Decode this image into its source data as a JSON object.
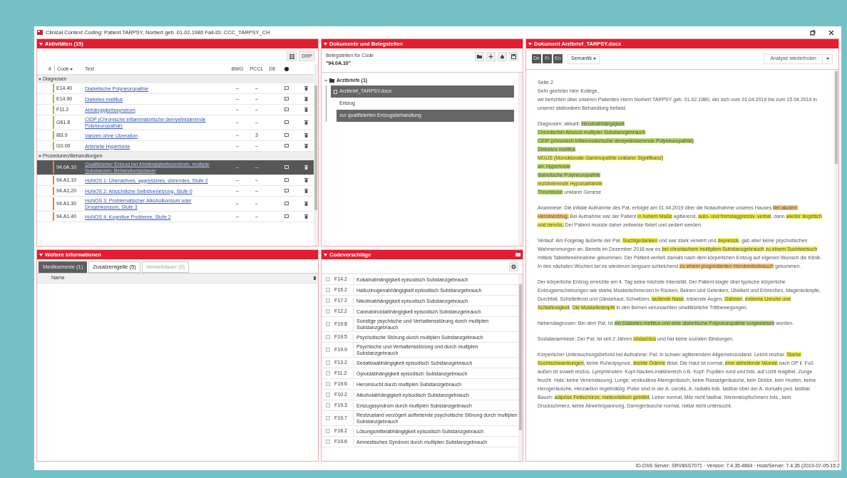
{
  "window": {
    "title": "Clinical Context Coding: Patient TARPSY, Norbert geb. 01.02.1980 Fall-ID: CCC_TARPSY_CH"
  },
  "activities": {
    "title": "Aktivitäten (15)",
    "toolbar_buttons": [
      "DRP"
    ],
    "columns": [
      "#",
      "Code",
      "Text",
      "BWG",
      "PCCL",
      "DE"
    ],
    "groups": [
      {
        "label": "Diagnosen",
        "expanded": true,
        "color": "#9bbf3a",
        "rows": [
          {
            "code": "E14.40",
            "text": "Diabetische Polyneuropathie",
            "bwg": "–",
            "pccl": "–",
            "selected": false
          },
          {
            "code": "E14.90",
            "text": "Diabetes mellitus",
            "bwg": "–",
            "pccl": "–",
            "selected": false
          },
          {
            "code": "F11.2",
            "text": "Abhängigkeitssyndrom",
            "bwg": "–",
            "pccl": "–",
            "selected": false
          },
          {
            "code": "G61.8",
            "text": "CIDP (Chronische inflammatorische demyelinisierende Polyneuropathie)",
            "bwg": "–",
            "pccl": "–",
            "selected": false
          },
          {
            "code": "I83.9",
            "text": "Varizen ohne Ulzeration",
            "bwg": "–",
            "pccl": "3",
            "selected": false
          },
          {
            "code": "I10.00",
            "text": "Arterielle Hypertonie",
            "bwg": "–",
            "pccl": "–",
            "selected": false
          }
        ]
      },
      {
        "label": "Prozeduren/Behandlungen",
        "expanded": true,
        "color": "#e8823a",
        "rows": [
          {
            "code": "94.0A.10",
            "text": "Qualifizierter Entzug bei Abhängigkeitssyndrom, multiple Substanzen, Behandlungsdauer",
            "bwg": "–",
            "pccl": "–",
            "selected": true
          },
          {
            "code": "94.A1.10",
            "text": "HoNOS 1: Überaktives, aggressives, störendes, Stufe 2",
            "bwg": "–",
            "pccl": "–",
            "selected": false
          },
          {
            "code": "94.A1.20",
            "text": "HoNOS 2: Absichtliche Selbstverletzung, Stufe 0",
            "bwg": "–",
            "pccl": "–",
            "selected": false
          },
          {
            "code": "94.A1.30",
            "text": "HoNOS 3: Problematischer Alkoholkonsum oder Drogenkonsum, Stufe 3",
            "bwg": "–",
            "pccl": "–",
            "selected": false
          },
          {
            "code": "94.A1.40",
            "text": "HoNOS 4: Kognitive Probleme, Stufe 2",
            "bwg": "–",
            "pccl": "–",
            "selected": false
          }
        ]
      }
    ]
  },
  "more_info": {
    "title": "Weitere Informationen",
    "tabs": [
      {
        "label": "Medikamente (1)",
        "selected": true,
        "disabled": false
      },
      {
        "label": "Zusatzentgelte (5)",
        "selected": false,
        "disabled": false
      },
      {
        "label": "Verweildauer (0)",
        "selected": false,
        "disabled": true
      }
    ],
    "columns": [
      "Name"
    ]
  },
  "evidence": {
    "title": "Dokumente und Belegstellen",
    "label": "Belegstellen für Code",
    "code": "\"94.0A.10\"",
    "tree": [
      {
        "label": "Arztbriefe (1)",
        "kind": "folder",
        "expanded": true,
        "selected": false,
        "children": [
          {
            "label": "Arztbrief_TARPSY.docx",
            "kind": "document",
            "expanded": true,
            "selected": true,
            "children": [
              {
                "label": "Entzug",
                "kind": "passage",
                "selected": false
              },
              {
                "label": "zur qualifizierten Entzugsbehandlung",
                "kind": "passage",
                "selected": true
              }
            ]
          }
        ]
      }
    ]
  },
  "suggestions": {
    "title": "Codevorschläge",
    "rows": [
      {
        "code": "F14.2",
        "text": "Kokainabhängigkeit episodisch Substanzgebrauch",
        "checked": false
      },
      {
        "code": "F15.2",
        "text": "Halluzinogenabhängigkeit episodisch Substanzgebrauch",
        "checked": false
      },
      {
        "code": "F17.2",
        "text": "Nikotinabhängigkeit episodisch Substanzgebrauch",
        "checked": false
      },
      {
        "code": "F12.2",
        "text": "Cannabinoidabhängigkeit episodisch Substanzgebrauch",
        "checked": false
      },
      {
        "code": "F19.8",
        "text": "Sonstige psychische und Verhaltensstörung durch multiplen Substanzgebrauch",
        "checked": false
      },
      {
        "code": "F19.5",
        "text": "Psychotische Störung durch multiplen Substanzgebrauch",
        "checked": false
      },
      {
        "code": "F19.9",
        "text": "Psychische und Verhaltensstörung und durch multiplen Substanzgebrauch",
        "checked": false
      },
      {
        "code": "F13.2",
        "text": "Sedativaabhängigkeit episodisch Substanzgebrauch",
        "checked": false
      },
      {
        "code": "F11.2",
        "text": "Opioidabhängigkeit episodisch Substanzgebrauch",
        "checked": false
      },
      {
        "code": "F19.6",
        "text": "Heroinsucht durch multiplen Substanzgebrauch",
        "checked": false
      },
      {
        "code": "F10.2",
        "text": "Alkoholabhängigkeit episodisch Substanzgebrauch",
        "checked": false
      },
      {
        "code": "F19.3",
        "text": "Entzugssyndrom durch multiplen Substanzgebrauch",
        "checked": false
      },
      {
        "code": "F19.7",
        "text": "Restzustand verzögert auftretende psychotische Störung durch multiplen Substanzgebrauch",
        "checked": false
      },
      {
        "code": "F18.2",
        "text": "Lösungsmittelabhängigkeit episodisch Substanzgebrauch",
        "checked": false
      },
      {
        "code": "F19.6",
        "text": "Amnestisches Syndrom durch multiplen Substanzgebrauch",
        "checked": false
      }
    ]
  },
  "document": {
    "title": "Dokument Arztbrief_TARPSY.docx",
    "languages": [
      {
        "label": "De",
        "selected": false
      },
      {
        "label": "Fr",
        "selected": false
      },
      {
        "label": "En",
        "selected": false
      }
    ],
    "menu": "Semantik",
    "action": "Analyse wiederholen",
    "blocks": [
      {
        "lines": [
          [
            {
              "t": "Seite 2"
            }
          ],
          [
            {
              "t": "Sehr geehrter Herr Kollege,"
            }
          ],
          [
            {
              "t": "wir berichten über unseren Patienten Herrn Norbert TARPSY geb. 01.02.1980, der sich vom 01.04.2019 bis zum 15.04.2019 in unserer stationären Behandlung befand."
            }
          ]
        ]
      },
      {
        "lines": [
          [
            {
              "t": "Diagnosen: aktuell: "
            },
            {
              "t": "Heroinabhängigkeit",
              "color": "#b8d86a"
            }
          ],
          [
            {
              "t": "Chronischer Abusus multipler Substanzgebrauch",
              "color": "#b8d86a"
            }
          ],
          [
            {
              "t": "CIDP (chronisch inflammatorische demyelinisierende Polyneuropathie)",
              "color": "#b8d86a"
            }
          ],
          [
            {
              "t": "Diabetes mellitus",
              "color": "#b8d86a"
            }
          ],
          [
            {
              "t": "MGUS (Monoklonale Gammopathie unklarer Signifikanz)",
              "color": "#ecec4e"
            }
          ],
          [
            {
              "t": "art. Hypertonie",
              "color": "#b8d86a"
            }
          ],
          [
            {
              "t": "diabetische Polyneuropathie",
              "color": "#b8d86a"
            }
          ],
          [
            {
              "t": "rezidivierende Hyponatriämie",
              "color": "#ecec4e"
            }
          ],
          [
            {
              "t": "Thrombose",
              "color": "#b8d86a"
            },
            {
              "t": " unklarer Genese"
            }
          ]
        ]
      },
      {
        "lines": [
          [
            {
              "t": "Anamnese: Die initiale Aufnahme des Pat. erfolgte am 01.04.2019 über die Notaufnahme unseres Hauses "
            },
            {
              "t": "bei akutem Heroinentzug.",
              "color": "#f3c57a"
            },
            {
              "t": " Bei Aufnahme war der Patient "
            },
            {
              "t": "in hohem Maße",
              "color": "#ecec4e"
            },
            {
              "t": " agitierend, "
            },
            {
              "t": "auto- und fremdaggressiv, verbal",
              "color": "#ecec4e"
            },
            {
              "t": ", dann "
            },
            {
              "t": "wieder ängstlich und nervös.",
              "color": "#ecec4e"
            },
            {
              "t": " Der Patient musste daher zeitweise fixiert und sediert werden."
            }
          ]
        ]
      },
      {
        "lines": [
          [
            {
              "t": "Verlauf: Am Folgetag äußerte der Pat. "
            },
            {
              "t": "Suchtgedanken",
              "color": "#ecec4e"
            },
            {
              "t": " und war stark verwirrt und "
            },
            {
              "t": "depressiv",
              "color": "#ecec4e"
            },
            {
              "t": ", gab aber keine psychotischen Wahrnehmungen an. Bereits im Dezember 2018 war es "
            },
            {
              "t": "bei chronischem multiplem Substanzgebrauch",
              "color": "#ecec4e"
            },
            {
              "t": "zu einem Suchtversuch",
              "color": "#ecec4e"
            },
            {
              "t": " mittels Tabletteneinnahme gekommen. Der Patient verließ damals nach dem körperlichen Entzug auf eigenen Wunsch die Klinik. In den nächsten Wochen sei es wiederum langsam schleichend "
            },
            {
              "t": "zu einem progredienten Heroinmissbrauch",
              "color": "#f3c57a"
            },
            {
              "t": " gekommen."
            }
          ]
        ]
      },
      {
        "lines": [
          [
            {
              "t": "Der körperliche Entzug erreichte am 4. Tag seine höchste Intensität. Der Patient klagte über typische körperliche Entzugserscheinungen wie starke Muskelschmerzen in Rücken, Beinen und Gelenken, Übelkeit und Erbrechen, Magenkrämpfe, Durchfall, Schüttelfrost und Gänsehaut, Schwitzen, "
            },
            {
              "t": "laufende Nase",
              "color": "#ecec4e"
            },
            {
              "t": ", tränende Augen, "
            },
            {
              "t": "Gähnen",
              "color": "#ecec4e"
            },
            {
              "t": ", "
            },
            {
              "t": "extreme Unruhe und Schlaflosigkeit",
              "color": "#ecec4e"
            },
            {
              "t": ". "
            },
            {
              "t": "Die Muskelkrämpfe",
              "color": "#ecec4e"
            },
            {
              "t": " in den Beinen verursachten unwillkürliche Trittbewegungen."
            }
          ]
        ]
      },
      {
        "lines": [
          [
            {
              "t": "Nebendiagnosen: Bei dem Pat. ist "
            },
            {
              "t": "ein Diabetes mellitus und eine diabetische Polyneuropathie vorgewiesen",
              "color": "#b8d86a"
            },
            {
              "t": " worden."
            }
          ]
        ]
      },
      {
        "lines": [
          [
            {
              "t": "Sozialanamnese: Der Pat. ist seit 2 Jahren "
            },
            {
              "t": "obdachlos",
              "color": "#ecec4e"
            },
            {
              "t": " und hat keine sozialen Bindungen."
            }
          ]
        ]
      },
      {
        "lines": [
          [
            {
              "t": "Körperlicher Untersuchungsbefund bei Aufnahme: Pat. in schwer agitierendem Allgemeinzustand. Leicht reizbar. "
            },
            {
              "t": "Starke Suchtschwankungen",
              "color": "#ecec4e"
            },
            {
              "t": ", keine Ruhedyspnoe, "
            },
            {
              "t": "leichte Ödeme",
              "color": "#ecec4e"
            },
            {
              "t": " tibial. Die Haut ist normal, "
            },
            {
              "t": "eine abheilende Wunde",
              "color": "#ecec4e"
            },
            {
              "t": " nach OP li. Fuß außen ist soweit reizlos. Lymphknoten: Kopf-Nacken-Halsbereich o.B. Kopf: Pupillen rund und bds. auf Licht reagibel. Zunge feucht. Hals: keine Venenstauung. Lunge: vesikuläres Atemgeräusch, keine Rasselgeräusche, kein Stridor, kein Husten, keine Herzgeräusche, Herzaktion regelmäßig. Pulse sind in der A. carotis, A. radialis bds. tastbar über der A. dorsalis ped. tastbar. Bauch: "
            },
            {
              "t": "adipöse Fettschürze, meteoristisch gebläht",
              "color": "#ecec4e"
            },
            {
              "t": ". Leber normal, Milz nicht tastbar. Nierenklopfschmerz bds., kein Druckschmerz, keine Abwehrspannung, Darmgeräusche normal, rektal nicht untersucht."
            }
          ]
        ]
      }
    ]
  },
  "status_bar": "ID-DSS Server: SRV8SS7071 · Version: 7.4.35.4864 · Host/Server: 7.4.35 (2019-07-05-15:2"
}
